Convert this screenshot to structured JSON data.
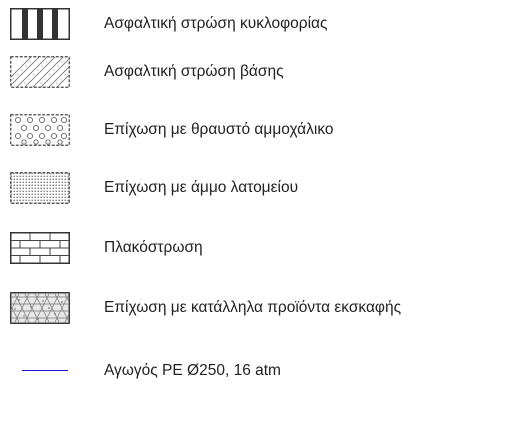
{
  "legend": {
    "items": [
      {
        "label": "Ασφαλτική στρώση κυκλοφορίας",
        "icon": "vertical-stripes-hatch-icon"
      },
      {
        "label": "Ασφαλτική στρώση βάσης",
        "icon": "diagonal-hatch-icon"
      },
      {
        "label": "Επίχωση με θραυστό αμμοχάλικο",
        "icon": "gravel-circles-hatch-icon"
      },
      {
        "label": "Επίχωση με άμμο λατομείου",
        "icon": "fine-dots-hatch-icon"
      },
      {
        "label": "Πλακόστρωση",
        "icon": "brick-hatch-icon"
      },
      {
        "label": "Επίχωση με κατάλληλα προϊόντα εκσκαφής",
        "icon": "triangle-mesh-hatch-icon"
      },
      {
        "label": "Αγωγός PE Ø250, 16 atm",
        "icon": "blue-line-icon"
      }
    ],
    "colors": {
      "outline": "#333333",
      "pipe": "#1a1ad6",
      "text": "#222222"
    }
  }
}
